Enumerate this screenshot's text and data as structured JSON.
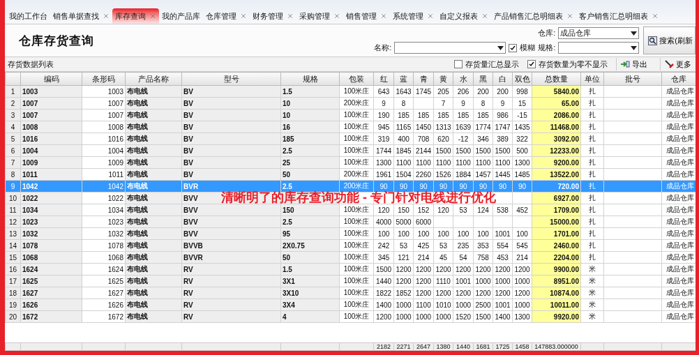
{
  "tabs": [
    {
      "label": "我的工作台",
      "selected": false,
      "closable": false
    },
    {
      "label": "销售单据查找",
      "selected": false,
      "closable": true
    },
    {
      "label": "库存查询",
      "selected": true,
      "closable": true
    },
    {
      "label": "我的产品库",
      "selected": false,
      "closable": false
    },
    {
      "label": "仓库管理",
      "selected": false,
      "closable": true
    },
    {
      "label": "财务管理",
      "selected": false,
      "closable": true
    },
    {
      "label": "采购管理",
      "selected": false,
      "closable": true
    },
    {
      "label": "销售管理",
      "selected": false,
      "closable": true
    },
    {
      "label": "系统管理",
      "selected": false,
      "closable": true
    },
    {
      "label": "自定义报表",
      "selected": false,
      "closable": true
    },
    {
      "label": "产品销售汇总明细表",
      "selected": false,
      "closable": true
    },
    {
      "label": "客户销售汇总明细表",
      "selected": false,
      "closable": true
    }
  ],
  "page_title": "仓库存货查询",
  "filters": {
    "name": {
      "label": "名称:"
    },
    "fuzzy": {
      "label": "模糊",
      "checked": true
    },
    "warehouse": {
      "label": "仓库:",
      "value": "成品仓库"
    },
    "spec": {
      "label": "规格:"
    },
    "search_button": "搜索(刷新"
  },
  "toolbar": {
    "label": "存货数据列表",
    "options": [
      {
        "label": "存货量汇总显示",
        "checked": false
      },
      {
        "label": "存货数量为零不显示",
        "checked": true
      }
    ],
    "export_button": "导出",
    "more_button": "更多"
  },
  "table": {
    "columns": [
      {
        "label": "编码",
        "kind": "bold"
      },
      {
        "label": "条形码",
        "kind": "right"
      },
      {
        "label": "产品名称",
        "kind": "bold"
      },
      {
        "label": "型号",
        "kind": "bold"
      },
      {
        "label": "规格",
        "kind": "bold"
      },
      {
        "label": "包装",
        "kind": "center"
      },
      {
        "label": "红",
        "kind": "center"
      },
      {
        "label": "蓝",
        "kind": "center"
      },
      {
        "label": "青",
        "kind": "center"
      },
      {
        "label": "黄",
        "kind": "center"
      },
      {
        "label": "水",
        "kind": "center"
      },
      {
        "label": "黑",
        "kind": "center"
      },
      {
        "label": "白",
        "kind": "center"
      },
      {
        "label": "双色",
        "kind": "center"
      },
      {
        "label": "总数量",
        "kind": "total"
      },
      {
        "label": "单位",
        "kind": "center"
      },
      {
        "label": "批号",
        "kind": "center"
      },
      {
        "label": "仓库",
        "kind": "right"
      }
    ],
    "rows": [
      {
        "no": "1",
        "selected": false,
        "cells": [
          "1003",
          "1003",
          "布电线",
          "BV",
          "1.5",
          "100米庄",
          "643",
          "1643",
          "1745",
          "205",
          "206",
          "200",
          "200",
          "998",
          "5840.00",
          "扎",
          null,
          "成品仓库"
        ]
      },
      {
        "no": "2",
        "selected": false,
        "cells": [
          "1007",
          "1007",
          "布电线",
          "BV",
          "10",
          "200米庄",
          "9",
          "8",
          null,
          "7",
          "9",
          "8",
          "9",
          "15",
          "65.00",
          "扎",
          null,
          "成品仓库"
        ]
      },
      {
        "no": "3",
        "selected": false,
        "cells": [
          "1007",
          "1007",
          "布电线",
          "BV",
          "10",
          "100米庄",
          "190",
          "185",
          "185",
          "185",
          "185",
          "185",
          "986",
          "-15",
          "2086.00",
          "扎",
          null,
          "成品仓库"
        ]
      },
      {
        "no": "4",
        "selected": false,
        "cells": [
          "1008",
          "1008",
          "布电线",
          "BV",
          "16",
          "100米庄",
          "945",
          "1165",
          "1450",
          "1313",
          "1639",
          "1774",
          "1747",
          "1435",
          "11468.00",
          "扎",
          null,
          "成品仓库"
        ]
      },
      {
        "no": "5",
        "selected": false,
        "cells": [
          "1016",
          "1016",
          "布电线",
          "BV",
          "185",
          "100米庄",
          "319",
          "400",
          "708",
          "620",
          "-12",
          "346",
          "389",
          "322",
          "3092.00",
          "扎",
          null,
          "成品仓库"
        ]
      },
      {
        "no": "6",
        "selected": false,
        "cells": [
          "1004",
          "1004",
          "布电线",
          "BV",
          "2.5",
          "100米庄",
          "1744",
          "1845",
          "2144",
          "1500",
          "1500",
          "1500",
          "1500",
          "500",
          "12233.00",
          "扎",
          null,
          "成品仓库"
        ]
      },
      {
        "no": "7",
        "selected": false,
        "cells": [
          "1009",
          "1009",
          "布电线",
          "BV",
          "25",
          "100米庄",
          "1300",
          "1100",
          "1100",
          "1100",
          "1100",
          "1100",
          "1100",
          "1300",
          "9200.00",
          "扎",
          null,
          "成品仓库"
        ]
      },
      {
        "no": "8",
        "selected": false,
        "cells": [
          "1011",
          "1011",
          "布电线",
          "BV",
          "50",
          "200米庄",
          "1961",
          "1504",
          "2260",
          "1526",
          "1884",
          "1457",
          "1445",
          "1485",
          "13522.00",
          "扎",
          null,
          "成品仓库"
        ]
      },
      {
        "no": "9",
        "selected": true,
        "cells": [
          "1042",
          "1042",
          "布电线",
          "BVR",
          "2.5",
          "200米庄",
          "90",
          "90",
          "90",
          "90",
          "90",
          "90",
          "90",
          "90",
          "720.00",
          "扎",
          null,
          "成品仓库"
        ]
      },
      {
        "no": "10",
        "selected": false,
        "cells": [
          "1022",
          "1022",
          "布电线",
          "BVV",
          null,
          null,
          null,
          null,
          null,
          null,
          null,
          null,
          null,
          null,
          "6927.00",
          "扎",
          null,
          "成品仓库"
        ]
      },
      {
        "no": "11",
        "selected": false,
        "cells": [
          "1034",
          "1034",
          "布电线",
          "BVV",
          "150",
          "100米庄",
          "120",
          "150",
          "152",
          "120",
          "53",
          "124",
          "538",
          "452",
          "1709.00",
          "扎",
          null,
          "成品仓库"
        ]
      },
      {
        "no": "12",
        "selected": false,
        "cells": [
          "1023",
          "1023",
          "布电线",
          "BVV",
          "2.5",
          "100米庄",
          "4000",
          "5000",
          "6000",
          null,
          null,
          null,
          null,
          null,
          "15000.00",
          "扎",
          null,
          "成品仓库"
        ]
      },
      {
        "no": "13",
        "selected": false,
        "cells": [
          "1032",
          "1032",
          "布电线",
          "BVV",
          "95",
          "100米庄",
          "100",
          "100",
          "100",
          "100",
          "100",
          "100",
          "1001",
          "100",
          "1701.00",
          "扎",
          null,
          "成品仓库"
        ]
      },
      {
        "no": "14",
        "selected": false,
        "cells": [
          "1078",
          "1078",
          "布电线",
          "BVVB",
          "2X0.75",
          "100米庄",
          "242",
          "53",
          "425",
          "53",
          "235",
          "353",
          "554",
          "545",
          "2460.00",
          "扎",
          null,
          "成品仓库"
        ]
      },
      {
        "no": "15",
        "selected": false,
        "cells": [
          "1068",
          "1068",
          "布电线",
          "BVVR",
          "50",
          "100米庄",
          "345",
          "121",
          "214",
          "45",
          "54",
          "758",
          "453",
          "214",
          "2204.00",
          "扎",
          null,
          "成品仓库"
        ]
      },
      {
        "no": "16",
        "selected": false,
        "cells": [
          "1624",
          "1624",
          "布电线",
          "RV",
          "1.5",
          "100米庄",
          "1500",
          "1200",
          "1200",
          "1200",
          "1200",
          "1200",
          "1200",
          "1200",
          "9900.00",
          "米",
          null,
          "成品仓库"
        ]
      },
      {
        "no": "17",
        "selected": false,
        "cells": [
          "1625",
          "1625",
          "布电线",
          "RV",
          "3X1",
          "100米庄",
          "1440",
          "1200",
          "1200",
          "1110",
          "1001",
          "1000",
          "1000",
          "1000",
          "8951.00",
          "米",
          null,
          "成品仓库"
        ]
      },
      {
        "no": "18",
        "selected": false,
        "cells": [
          "1627",
          "1627",
          "布电线",
          "RV",
          "3X10",
          "100米庄",
          "1822",
          "1852",
          "1200",
          "1200",
          "1200",
          "1200",
          "1200",
          "1200",
          "10874.00",
          "米",
          null,
          "成品仓库"
        ]
      },
      {
        "no": "19",
        "selected": false,
        "cells": [
          "1626",
          "1626",
          "布电线",
          "RV",
          "3X4",
          "100米庄",
          "1400",
          "1000",
          "1100",
          "1010",
          "1000",
          "2500",
          "1001",
          "1000",
          "10011.00",
          "米",
          null,
          "成品仓库"
        ]
      },
      {
        "no": "20",
        "selected": false,
        "cells": [
          "1672",
          "1672",
          "布电线",
          "RV",
          "4",
          "100米庄",
          "1200",
          "1000",
          "1000",
          "1000",
          "1520",
          "1500",
          "1400",
          "1300",
          "9920.00",
          "米",
          null,
          "成品仓库"
        ]
      }
    ],
    "totals": {
      "cells": [
        null,
        null,
        null,
        null,
        null,
        null,
        "2182",
        "2271",
        "2647",
        "1380",
        "1440",
        "1681",
        "1725",
        "1458",
        "147883.000000",
        null,
        null,
        null
      ]
    }
  },
  "caption": "清晰明了的库存查询功能 - 专门针对电线进行优化"
}
